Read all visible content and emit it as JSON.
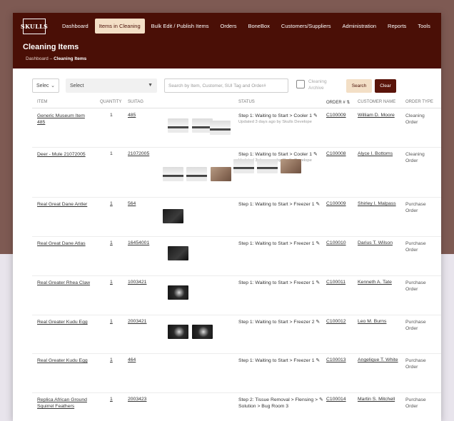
{
  "header": {
    "logo_text": "SKULLS",
    "nav": [
      {
        "label": "Dashboard",
        "active": false
      },
      {
        "label": "Items in Cleaning",
        "active": true
      },
      {
        "label": "Bulk Edit / Publish Items",
        "active": false
      },
      {
        "label": "Orders",
        "active": false
      },
      {
        "label": "BoneBox",
        "active": false
      },
      {
        "label": "Customers/Suppliers",
        "active": false
      },
      {
        "label": "Administration",
        "active": false
      },
      {
        "label": "Reports",
        "active": false
      },
      {
        "label": "Tools",
        "active": false
      }
    ],
    "title": "Cleaning Items",
    "breadcrumb": {
      "home": "Dashboard",
      "sep": "–",
      "current": "Cleaning Items"
    }
  },
  "filters": {
    "select1": "Selec",
    "select2": "Select",
    "search_placeholder": "Search by Item, Customer, SUI Tag and Order#",
    "archive_label": "Cleaning Archive",
    "search_button": "Search",
    "clear_button": "Clear"
  },
  "table": {
    "headers": {
      "item": "ITEM",
      "quantity": "QUANTITY",
      "suitag": "SUITAG",
      "status": "STATUS",
      "order": "ORDER #",
      "customer": "CUSTOMER NAME",
      "order_type": "ORDER TYPE"
    },
    "rows": [
      {
        "item": "Generic Museum Item 485",
        "qty": "1",
        "tag": "485",
        "status": "Step 1: Waiting to Start > Cooler 1",
        "updated": "Updated 3 days ago by Skulls Develope",
        "order": "C100009",
        "customer": "William D. Moore",
        "type": "Cleaning Order",
        "thumbs": [
          "t-lab",
          "t-lab",
          "t-lab"
        ]
      },
      {
        "item": "Deer - Mule 21072005",
        "qty": "1",
        "tag": "21072005",
        "status": "Step 1: Waiting to Start > Cooler 1",
        "updated": "Updated 3 days ago by Skulls Develope",
        "order": "C100008",
        "customer": "Alyce I. Bottoms",
        "type": "Cleaning Order",
        "thumbs": [
          "t-lab",
          "t-lab",
          "t-tan",
          "t-lab",
          "t-lab",
          "t-tan"
        ]
      },
      {
        "item": "Real Great Dane Antler",
        "qty": "1",
        "tag": "564",
        "status": "Step 1: Waiting to Start > Freezer 1",
        "updated": "",
        "order": "C100009",
        "customer": "Shirley I. Malpass",
        "type": "Purchase Order",
        "thumbs": [
          "t-dark"
        ]
      },
      {
        "item": "Real Great Dane Atlas",
        "qty": "1",
        "tag": "16454001",
        "status": "Step 1: Waiting to Start > Freezer 1",
        "updated": "",
        "order": "C100010",
        "customer": "Darius T. Wilson",
        "type": "Purchase Order",
        "thumbs": [
          "t-dark"
        ]
      },
      {
        "item": "Real Greater Rhea Claw",
        "qty": "1",
        "tag": "1003421",
        "status": "Step 1: Waiting to Start > Freezer 1",
        "updated": "",
        "order": "C100011",
        "customer": "Kenneth A. Tate",
        "type": "Purchase Order",
        "thumbs": [
          "t-bone"
        ]
      },
      {
        "item": "Real Greater Kudu Egg",
        "qty": "1",
        "tag": "2003421",
        "status": "Step 1: Waiting to Start > Freezer 2",
        "updated": "",
        "order": "C100012",
        "customer": "Leo M. Burns",
        "type": "Purchase Order",
        "thumbs": [
          "t-bone",
          "t-bone"
        ]
      },
      {
        "item": "Real Greater Kudu Egg",
        "qty": "1",
        "tag": "464",
        "status": "Step 1: Waiting to Start > Freezer 1",
        "updated": "",
        "order": "C100013",
        "customer": "Angelique T. White",
        "type": "Purchase Order",
        "thumbs": []
      },
      {
        "item": "Replica African Ground Squirrel Feathers",
        "qty": "1",
        "tag": "2003423",
        "status": "Step 2: Tissue Removal > Flensing >",
        "status2": "Solution > Bug Room 3",
        "updated": "",
        "order": "C100014",
        "customer": "Martin S. Mitchell",
        "type": "Purchase Order",
        "thumbs": []
      }
    ]
  },
  "colors": {
    "header_bg": "#4a0f06",
    "active_tab_bg": "#f3dfc6",
    "clear_btn": "#5a140a",
    "page_bg": "#7e5a53"
  },
  "icons": {
    "edit": "pencil-icon",
    "sort": "sort-icon"
  }
}
